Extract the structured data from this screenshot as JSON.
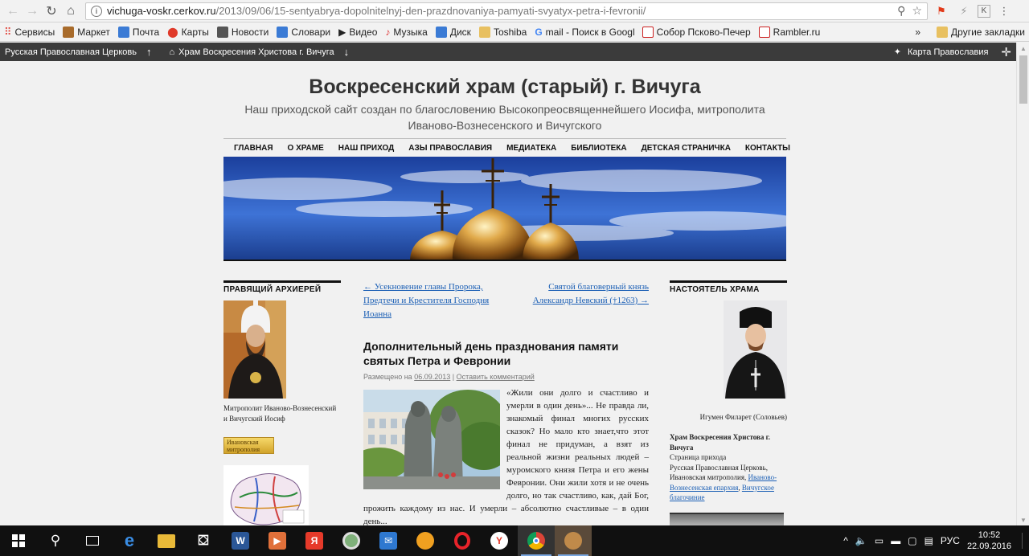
{
  "browser": {
    "url_host": "vichuga-voskr.cerkov.ru",
    "url_path": "/2013/09/06/15-sentyabrya-dopolnitelnyj-den-prazdnovaniya-pamyati-svyatyx-petra-i-fevronii/",
    "ext_label": "K"
  },
  "bookmarks": {
    "items": [
      {
        "label": "Сервисы",
        "color": "#e04a3a"
      },
      {
        "label": "Маркет",
        "color": "#a86b2b"
      },
      {
        "label": "Почта",
        "color": "#3b7bd5"
      },
      {
        "label": "Карты",
        "color": "#e03a2a"
      },
      {
        "label": "Новости",
        "color": "#444444"
      },
      {
        "label": "Словари",
        "color": "#3b7bd5"
      },
      {
        "label": "Видео",
        "color": "#222222"
      },
      {
        "label": "Музыка",
        "color": "#d33"
      },
      {
        "label": "Диск",
        "color": "#3b7bd5"
      },
      {
        "label": "Toshiba",
        "color": "#e8b838"
      },
      {
        "label": "mail - Поиск в Google",
        "color": "#4285f4"
      },
      {
        "label": "Собор Псково-Печер",
        "color": "#cc2222"
      },
      {
        "label": "Rambler.ru",
        "color": "#cc2222"
      }
    ],
    "more": "»",
    "other_label": "Другие закладки"
  },
  "ortho_bar": {
    "church": "Русская Православная Церковь",
    "temple": "Храм Воскресения Христова г. Вичуга",
    "map": "Карта Православия"
  },
  "site": {
    "title": "Воскресенский храм (старый) г. Вичуга",
    "description": "Наш приходской сайт создан по благословению Высокопреосвященнейшего Иосифа, митрополита Иваново-Вознесенского и Вичугского",
    "nav": [
      "ГЛАВНАЯ",
      "О ХРАМЕ",
      "НАШ ПРИХОД",
      "АЗЫ ПРАВОСЛАВИЯ",
      "МЕДИАТЕКА",
      "БИБЛИОТЕКА",
      "ДЕТСКАЯ СТРАНИЧКА",
      "КОНТАКТЫ"
    ]
  },
  "left_sidebar": {
    "title": "ПРАВЯЩИЙ АРХИЕРЕЙ",
    "caption": "Митрополит Иваново-Вознесенский и Вичугский Иосиф",
    "badge": "Ивановская митрополия"
  },
  "right_sidebar": {
    "title": "НАСТОЯТЕЛЬ ХРАМА",
    "caption": "Игумен Филарет (Соловьев)",
    "info_title": "Храм Воскресения Христова г. Вичуга",
    "info_line1": "Страница прихода",
    "info_line2": "Русская Православная Церковь, Ивановская митрополия,",
    "link1": "Иваново-Вознесенская епархия",
    "sep": ",",
    "link2": "Вичугское благочиние"
  },
  "post": {
    "prev": "← Усекновение главы Пророка, Предтечи и Крестителя Господня Иоанна",
    "next": "Святой благоверный князь Александр Невский (†1263) →",
    "title": "Дополнительный день празднования памяти святых Петра и Февронии",
    "meta_prefix": "Размещено на",
    "meta_date": "06.09.2013",
    "meta_sep": "|",
    "meta_comment": "Оставить комментарий",
    "body": "«Жили они долго и счастливо и умерли в один день»... Не правда ли, знакомый финал многих русских сказок? Но мало кто знает,что этот финал не придуман, а взят из реальной жизни реальных людей – муромского князя Петра и его жены Февронии. Они жили хотя и не очень долго, но так счастливо, как, дай Бог, прожить каждому из нас. И умерли – абсолютно счастливые – в один день..."
  },
  "taskbar": {
    "lang": "РУС",
    "time": "10:52",
    "date": "22.09.2016"
  }
}
